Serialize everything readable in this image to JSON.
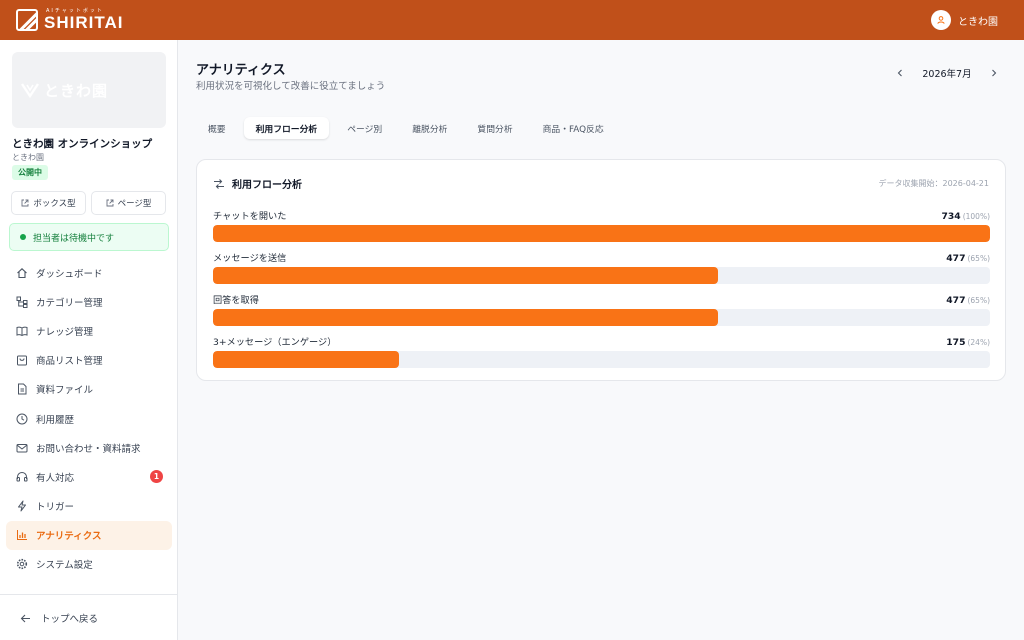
{
  "app": {
    "logo_sub": "AIチャットボット",
    "logo_main": "SHIRITAI",
    "user_name": "ときわ園"
  },
  "sidebar": {
    "shop_thumb_text": "ときわ園",
    "shop_name": "ときわ園 オンラインショップ",
    "shop_sub": "ときわ園",
    "status": "公開中",
    "box_button": "ボックス型",
    "page_button": "ページ型",
    "operator_status": "担当者は待機中です",
    "items": [
      {
        "label": "ダッシュボード",
        "icon": "home-icon"
      },
      {
        "label": "カテゴリー管理",
        "icon": "tree-icon"
      },
      {
        "label": "ナレッジ管理",
        "icon": "book-icon"
      },
      {
        "label": "商品リスト管理",
        "icon": "bag-icon"
      },
      {
        "label": "資料ファイル",
        "icon": "file-icon"
      },
      {
        "label": "利用履歴",
        "icon": "clock-icon"
      },
      {
        "label": "お問い合わせ・資料請求",
        "icon": "mail-icon"
      },
      {
        "label": "有人対応",
        "icon": "headset-icon",
        "badge": "1"
      },
      {
        "label": "トリガー",
        "icon": "bolt-icon"
      },
      {
        "label": "アナリティクス",
        "icon": "chart-icon",
        "active": true
      },
      {
        "label": "システム設定",
        "icon": "gear-icon"
      }
    ],
    "back_link": "トップへ戻る"
  },
  "main": {
    "title": "アナリティクス",
    "subtitle": "利用状況を可視化して改善に役立てましょう",
    "month": "2026年7月",
    "tabs": [
      {
        "label": "概要"
      },
      {
        "label": "利用フロー分析",
        "active": true
      },
      {
        "label": "ページ別"
      },
      {
        "label": "離脱分析"
      },
      {
        "label": "質問分析"
      },
      {
        "label": "商品・FAQ反応"
      }
    ],
    "card": {
      "title": "利用フロー分析",
      "meta": "データ収集開始：2026-04-21",
      "steps": [
        {
          "label": "チャットを開いた",
          "value": "734",
          "pct": "(100%)",
          "fraction": 1.0
        },
        {
          "label": "メッセージを送信",
          "value": "477",
          "pct": "(65%)",
          "fraction": 0.65
        },
        {
          "label": "回答を取得",
          "value": "477",
          "pct": "(65%)",
          "fraction": 0.65
        },
        {
          "label": "3+メッセージ（エンゲージ）",
          "value": "175",
          "pct": "(24%)",
          "fraction": 0.24
        }
      ]
    }
  },
  "colors": {
    "topbar": "#c0501a",
    "accent": "#f97316",
    "active_bg": "#fdf2e7",
    "success": "#16a34a"
  }
}
